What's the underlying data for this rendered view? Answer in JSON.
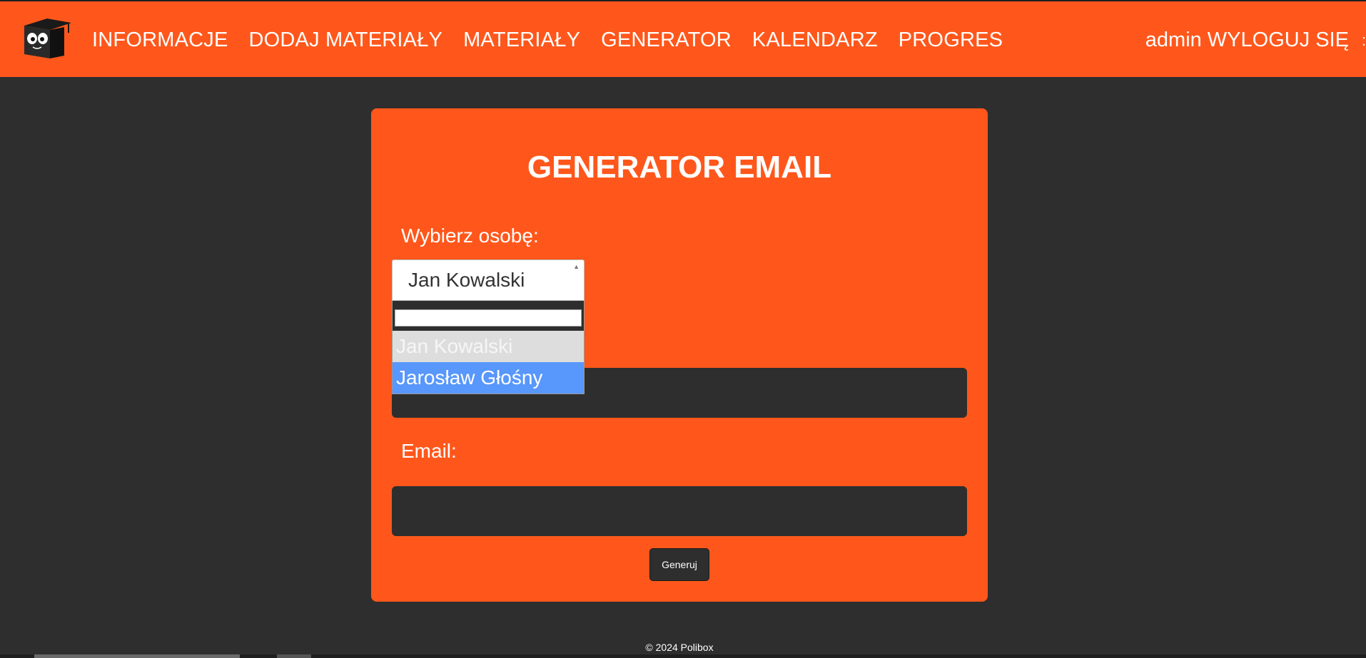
{
  "nav": {
    "items": [
      {
        "label": "INFORMACJE"
      },
      {
        "label": "DODAJ MATERIAŁY"
      },
      {
        "label": "MATERIAŁY"
      },
      {
        "label": "GENERATOR"
      },
      {
        "label": "KALENDARZ"
      },
      {
        "label": "PROGRES"
      }
    ],
    "username": "admin",
    "logout_label": "WYLOGUJ SIĘ",
    "logo_icon": "owl-graduation-cap-icon"
  },
  "form": {
    "title": "GENERATOR EMAIL",
    "person_label": "Wybierz osobę:",
    "person_selected": "Jan Kowalski",
    "person_search_value": "",
    "person_options": [
      {
        "label": "Jan Kowalski",
        "state": "selected"
      },
      {
        "label": "Jarosław Głośny",
        "state": "highlighted"
      }
    ],
    "subject_value": "",
    "email_label": "Email:",
    "email_value": "",
    "generate_label": "Generuj"
  },
  "footer": {
    "text": "© 2024 Polibox"
  },
  "colors": {
    "accent": "#ff571b",
    "background": "#2e2e2e",
    "highlight": "#5897fb"
  }
}
